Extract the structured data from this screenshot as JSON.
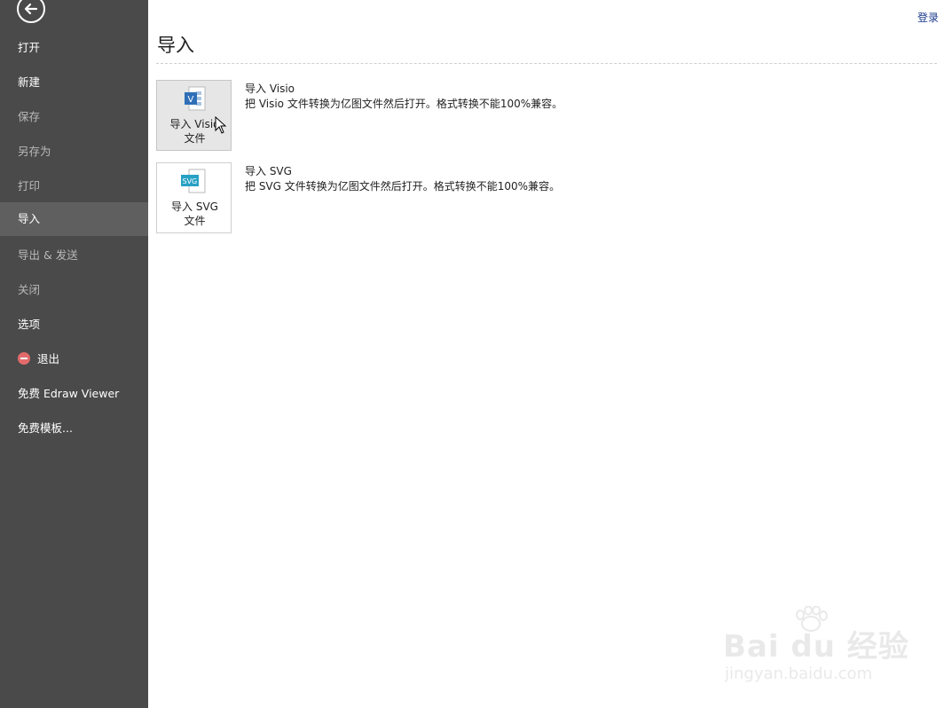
{
  "sidebar": {
    "items": [
      {
        "label": "打开"
      },
      {
        "label": "新建"
      },
      {
        "label": "保存"
      },
      {
        "label": "另存为"
      },
      {
        "label": "打印"
      },
      {
        "label": "导入"
      },
      {
        "label": "导出 & 发送"
      },
      {
        "label": "关闭"
      },
      {
        "label": "选项"
      },
      {
        "label": "退出"
      },
      {
        "label": "免费 Edraw Viewer"
      },
      {
        "label": "免费模板..."
      }
    ],
    "active_item": "导入"
  },
  "header": {
    "login": "登录",
    "title": "导入"
  },
  "imports": [
    {
      "button_line1": "导入 Visio",
      "button_line2": "文件",
      "title": "导入 Visio",
      "description": "把 Visio 文件转换为亿图文件然后打开。格式转换不能100%兼容。",
      "icon": "visio-file-icon"
    },
    {
      "button_line1": "导入 SVG",
      "button_line2": "文件",
      "title": "导入 SVG",
      "description": "把 SVG 文件转换为亿图文件然后打开。格式转换不能100%兼容。",
      "icon": "svg-file-icon"
    }
  ],
  "watermark": {
    "brand": "Bai du 经验",
    "url": "jingyan.baidu.com"
  },
  "colors": {
    "sidebar_bg": "#4a4a4a",
    "sidebar_active": "#5f5f5f",
    "link": "#1b3b8c"
  }
}
